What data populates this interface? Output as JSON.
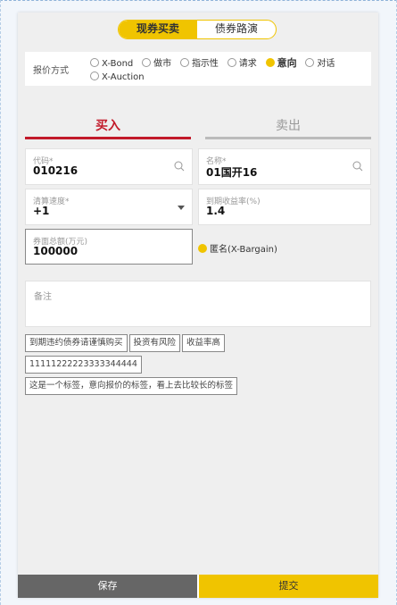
{
  "segments": [
    {
      "label": "现券买卖",
      "active": true
    },
    {
      "label": "债券路演",
      "active": false
    }
  ],
  "quote": {
    "label": "报价方式",
    "options": [
      {
        "label": "X-Bond",
        "checked": false
      },
      {
        "label": "做市",
        "checked": false
      },
      {
        "label": "指示性",
        "checked": false
      },
      {
        "label": "请求",
        "checked": false
      },
      {
        "label": "意向",
        "checked": true
      },
      {
        "label": "对话",
        "checked": false
      },
      {
        "label": "X-Auction",
        "checked": false
      }
    ]
  },
  "tabs": {
    "buy": "买入",
    "sell": "卖出"
  },
  "fields": {
    "code": {
      "label": "代码*",
      "value": "010216"
    },
    "name": {
      "label": "名称*",
      "value": "01国开16"
    },
    "speed": {
      "label": "清算速度*",
      "value": "+1"
    },
    "yield": {
      "label": "到期收益率(%)",
      "value": "1.4"
    },
    "amount": {
      "label": "券面总额(万元)",
      "value": "100000"
    }
  },
  "anonymous": {
    "label": "匿名(X-Bargain)",
    "checked": true
  },
  "remark": {
    "label": "备注"
  },
  "tags": [
    "到期违约债券请谨慎购买",
    "投资有风险",
    "收益率高",
    "11111222223333344444",
    "这是一个标签，意向报价的标签，看上去比较长的标签"
  ],
  "footer": {
    "save": "保存",
    "submit": "提交"
  },
  "colors": {
    "accent": "#f0c400",
    "buy": "#c21a2a",
    "save_bg": "#666666"
  }
}
